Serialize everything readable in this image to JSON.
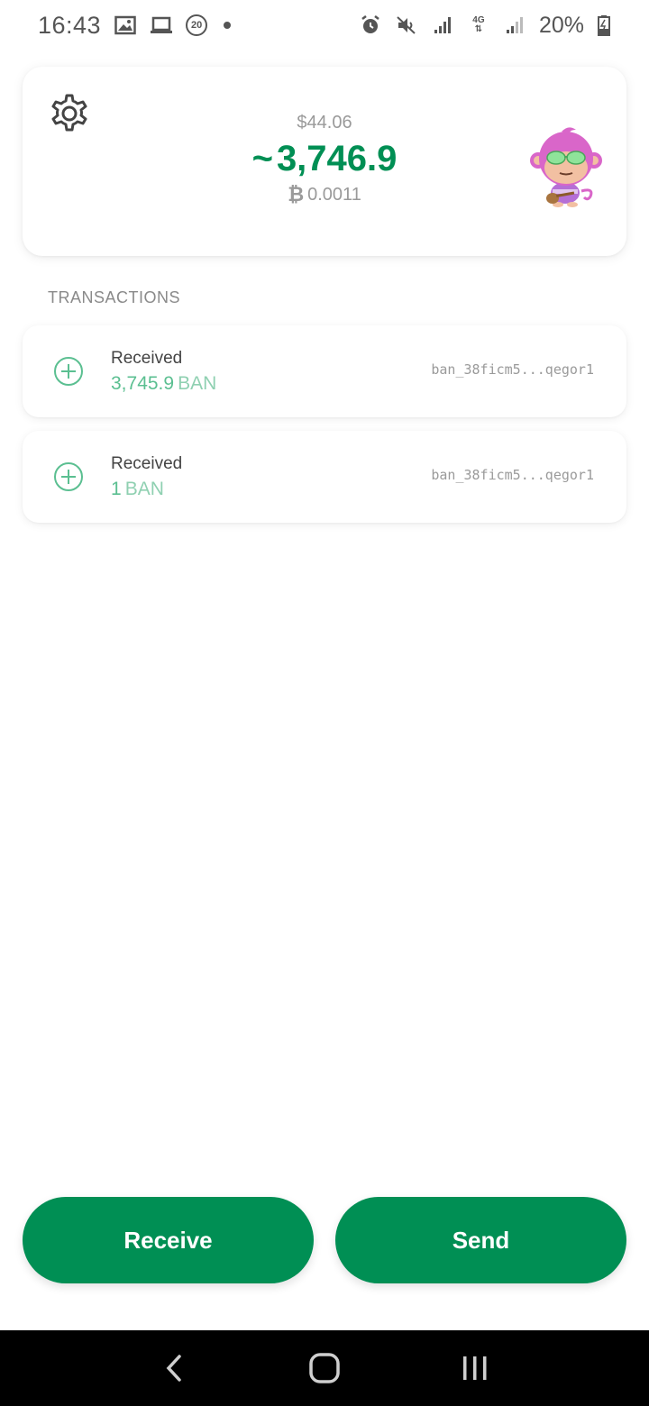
{
  "status_bar": {
    "time": "16:43",
    "notification_badge": "20",
    "battery": "20%",
    "network": "4G"
  },
  "balance": {
    "fiat": "$44.06",
    "prefix": "~",
    "amount": "3,746.9",
    "btc": "0.0011",
    "btc_symbol": "₿"
  },
  "transactions": {
    "header": "TRANSACTIONS",
    "items": [
      {
        "type": "Received",
        "amount": "3,745.9",
        "unit": "BAN",
        "address": "ban_38ficm5...qegor1"
      },
      {
        "type": "Received",
        "amount": "1",
        "unit": "BAN",
        "address": "ban_38ficm5...qegor1"
      }
    ]
  },
  "actions": {
    "receive_label": "Receive",
    "send_label": "Send"
  },
  "colors": {
    "accent": "#008f54",
    "accent_light": "#5bbf91"
  },
  "icons": {
    "settings": "gear-icon",
    "tx": "plus-circle-icon",
    "avatar": "monkey-avatar",
    "nav_back": "back-icon",
    "nav_home": "home-icon",
    "nav_recent": "recents-icon"
  }
}
